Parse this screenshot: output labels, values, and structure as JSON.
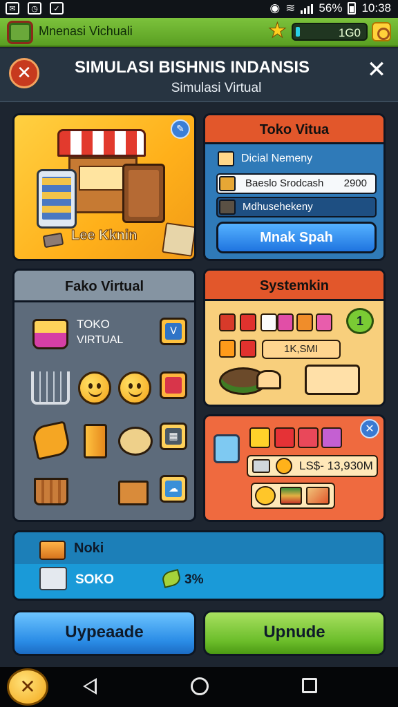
{
  "status_bar": {
    "battery": "56%",
    "time": "10:38"
  },
  "app_bar": {
    "app_name": "Mnenasi Vichuali",
    "coins": "1G0"
  },
  "header": {
    "title": "SIMULASI BISHNIS INDANSIS",
    "subtitle": "Simulasi Virtual"
  },
  "hero": {
    "label": "Lee Kknin"
  },
  "toko_panel": {
    "title": "Toko Vitua",
    "row1_label": "Dicial Nemeny",
    "row2_label": "Baeslo Srodcash",
    "row2_value": "2900",
    "row3_label": "Mdhusehekeny",
    "action_label": "Mnak Spah"
  },
  "fako_panel": {
    "title": "Fako Virtual",
    "item_title": "TOKO",
    "item_subtitle": "VIRTUAL",
    "badge_glyph": "V"
  },
  "system_panel": {
    "title": "Systemkin",
    "value": "1K,SMI",
    "badge": "1"
  },
  "stats_panel": {
    "value": "LS$- 13,930M"
  },
  "noki_bar": {
    "title": "Noki",
    "label": "SOKO",
    "percent": "3%"
  },
  "buttons": {
    "left": "Uypeaade",
    "right": "Upnude"
  },
  "colors": {
    "accent_orange": "#e2572b",
    "accent_blue": "#2f7ab8",
    "accent_green": "#6bbd2a",
    "accent_yellow": "#ffc23e"
  }
}
